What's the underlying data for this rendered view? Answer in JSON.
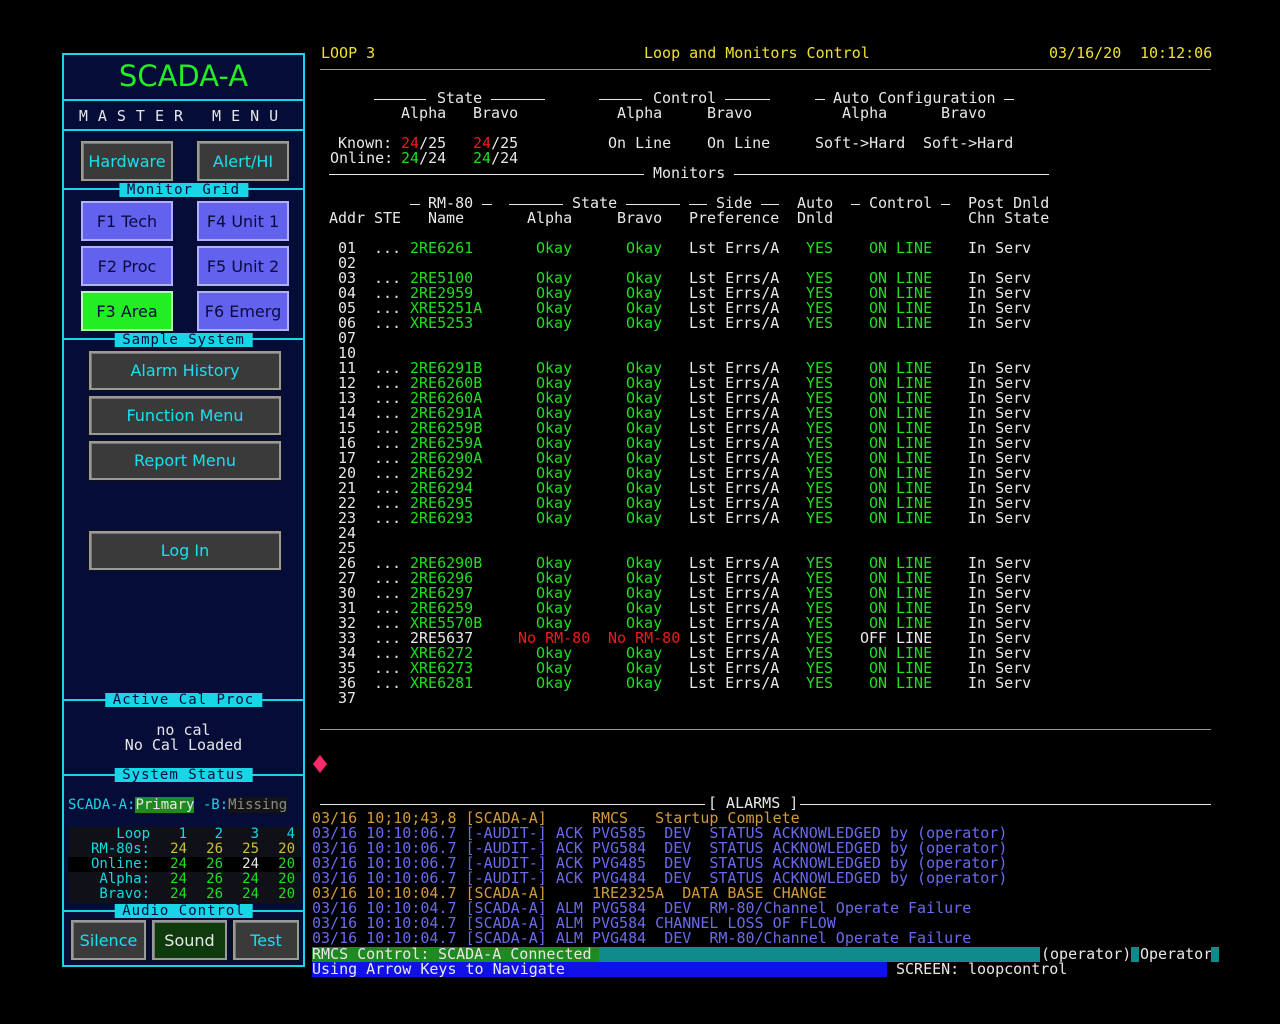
{
  "left_panel": {
    "title": "SCADA-A",
    "master_menu": "MASTER  MENU",
    "buttons_top": {
      "hardware": "Hardware",
      "alert": "Alert/HI"
    },
    "monitor_grid_label": "Monitor Grid",
    "grid_buttons": {
      "f1": "F1 Tech",
      "f4": "F4 Unit 1",
      "f2": "F2 Proc",
      "f5": "F5 Unit 2",
      "f3": "F3 Area",
      "f6": "F6 Emerg"
    },
    "sample_system_label": "Sample System",
    "menu_buttons": {
      "alarm_history": "Alarm History",
      "function_menu": "Function Menu",
      "report_menu": "Report Menu",
      "log_in": "Log In"
    },
    "active_cal_label": "Active Cal Proc",
    "cal_line1": "no cal",
    "cal_line2": "No Cal Loaded",
    "system_status_label": "System  Status",
    "scada_a_label": "SCADA-A:",
    "scada_a_value": "Primary",
    "scada_b_label": " -B:",
    "scada_b_value": "Missing",
    "loop_grid": {
      "rows": [
        {
          "label": "Loop",
          "values": [
            "1",
            "2",
            "3",
            "4"
          ]
        },
        {
          "label": "RM-80s:",
          "values": [
            "24",
            "26",
            "25",
            "20"
          ]
        },
        {
          "label": "Online:",
          "values": [
            "24",
            "26",
            "24",
            "20"
          ]
        },
        {
          "label": "Alpha:",
          "values": [
            "24",
            "26",
            "24",
            "20"
          ]
        },
        {
          "label": "Bravo:",
          "values": [
            "24",
            "26",
            "24",
            "20"
          ]
        }
      ]
    },
    "audio_control_label": "Audio Control",
    "audio_buttons": {
      "silence": "Silence",
      "sound": "Sound",
      "test": "Test"
    }
  },
  "header": {
    "loop": "LOOP 3",
    "title": "Loop and Monitors Control",
    "date": "03/16/20",
    "time": "10:12:06"
  },
  "summary": {
    "state_heading": "State",
    "control_heading": "Control",
    "auto_config_heading": "Auto Configuration",
    "alpha": "Alpha",
    "bravo": "Bravo",
    "known_label": "Known:",
    "online_label": "Online:",
    "known_alpha_num": "24",
    "known_alpha_den": "/25",
    "known_bravo_num": "24",
    "known_bravo_den": "/25",
    "online_alpha_num": "24",
    "online_alpha_den": "/24",
    "online_bravo_num": "24",
    "online_bravo_den": "/24",
    "control_alpha": "On Line",
    "control_bravo": "On Line",
    "auto_alpha": "Soft->Hard",
    "auto_bravo": "Soft->Hard",
    "monitors_heading": "Monitors"
  },
  "monitor_headers": {
    "addr": "Addr",
    "ste": "STE",
    "rm80_top": "RM-80",
    "rm80_bottom": "Name",
    "state_top": "State",
    "state_alpha": "Alpha",
    "state_bravo": "Bravo",
    "side_top": "Side",
    "side_bottom": "Preference",
    "auto_top": "Auto",
    "auto_bottom": "Dnld",
    "control_top": "Control",
    "post_top": "Post Dnld",
    "post_bottom": "Chn State"
  },
  "monitor_rows": [
    {
      "addr": "01",
      "ste": "...",
      "name": "2RE6261",
      "alpha": "Okay",
      "bravo": "Okay",
      "side": "Lst Errs/A",
      "auto": "YES",
      "ctl1": "ON",
      "ctl2": "LINE",
      "post": "In Serv"
    },
    {
      "addr": "02",
      "ste": "",
      "name": "",
      "alpha": "",
      "bravo": "",
      "side": "",
      "auto": "",
      "ctl1": "",
      "ctl2": "",
      "post": ""
    },
    {
      "addr": "03",
      "ste": "...",
      "name": "2RE5100",
      "alpha": "Okay",
      "bravo": "Okay",
      "side": "Lst Errs/A",
      "auto": "YES",
      "ctl1": "ON",
      "ctl2": "LINE",
      "post": "In Serv"
    },
    {
      "addr": "04",
      "ste": "...",
      "name": "2RE2959",
      "alpha": "Okay",
      "bravo": "Okay",
      "side": "Lst Errs/A",
      "auto": "YES",
      "ctl1": "ON",
      "ctl2": "LINE",
      "post": "In Serv"
    },
    {
      "addr": "05",
      "ste": "...",
      "name": "XRE5251A",
      "alpha": "Okay",
      "bravo": "Okay",
      "side": "Lst Errs/A",
      "auto": "YES",
      "ctl1": "ON",
      "ctl2": "LINE",
      "post": "In Serv"
    },
    {
      "addr": "06",
      "ste": "...",
      "name": "XRE5253",
      "alpha": "Okay",
      "bravo": "Okay",
      "side": "Lst Errs/A",
      "auto": "YES",
      "ctl1": "ON",
      "ctl2": "LINE",
      "post": "In Serv"
    },
    {
      "addr": "07",
      "ste": "",
      "name": "",
      "alpha": "",
      "bravo": "",
      "side": "",
      "auto": "",
      "ctl1": "",
      "ctl2": "",
      "post": ""
    },
    {
      "addr": "10",
      "ste": "",
      "name": "",
      "alpha": "",
      "bravo": "",
      "side": "",
      "auto": "",
      "ctl1": "",
      "ctl2": "",
      "post": ""
    },
    {
      "addr": "11",
      "ste": "...",
      "name": "2RE6291B",
      "alpha": "Okay",
      "bravo": "Okay",
      "side": "Lst Errs/A",
      "auto": "YES",
      "ctl1": "ON",
      "ctl2": "LINE",
      "post": "In Serv"
    },
    {
      "addr": "12",
      "ste": "...",
      "name": "2RE6260B",
      "alpha": "Okay",
      "bravo": "Okay",
      "side": "Lst Errs/A",
      "auto": "YES",
      "ctl1": "ON",
      "ctl2": "LINE",
      "post": "In Serv"
    },
    {
      "addr": "13",
      "ste": "...",
      "name": "2RE6260A",
      "alpha": "Okay",
      "bravo": "Okay",
      "side": "Lst Errs/A",
      "auto": "YES",
      "ctl1": "ON",
      "ctl2": "LINE",
      "post": "In Serv"
    },
    {
      "addr": "14",
      "ste": "...",
      "name": "2RE6291A",
      "alpha": "Okay",
      "bravo": "Okay",
      "side": "Lst Errs/A",
      "auto": "YES",
      "ctl1": "ON",
      "ctl2": "LINE",
      "post": "In Serv"
    },
    {
      "addr": "15",
      "ste": "...",
      "name": "2RE6259B",
      "alpha": "Okay",
      "bravo": "Okay",
      "side": "Lst Errs/A",
      "auto": "YES",
      "ctl1": "ON",
      "ctl2": "LINE",
      "post": "In Serv"
    },
    {
      "addr": "16",
      "ste": "...",
      "name": "2RE6259A",
      "alpha": "Okay",
      "bravo": "Okay",
      "side": "Lst Errs/A",
      "auto": "YES",
      "ctl1": "ON",
      "ctl2": "LINE",
      "post": "In Serv"
    },
    {
      "addr": "17",
      "ste": "...",
      "name": "2RE6290A",
      "alpha": "Okay",
      "bravo": "Okay",
      "side": "Lst Errs/A",
      "auto": "YES",
      "ctl1": "ON",
      "ctl2": "LINE",
      "post": "In Serv"
    },
    {
      "addr": "20",
      "ste": "...",
      "name": "2RE6292",
      "alpha": "Okay",
      "bravo": "Okay",
      "side": "Lst Errs/A",
      "auto": "YES",
      "ctl1": "ON",
      "ctl2": "LINE",
      "post": "In Serv"
    },
    {
      "addr": "21",
      "ste": "...",
      "name": "2RE6294",
      "alpha": "Okay",
      "bravo": "Okay",
      "side": "Lst Errs/A",
      "auto": "YES",
      "ctl1": "ON",
      "ctl2": "LINE",
      "post": "In Serv"
    },
    {
      "addr": "22",
      "ste": "...",
      "name": "2RE6295",
      "alpha": "Okay",
      "bravo": "Okay",
      "side": "Lst Errs/A",
      "auto": "YES",
      "ctl1": "ON",
      "ctl2": "LINE",
      "post": "In Serv"
    },
    {
      "addr": "23",
      "ste": "...",
      "name": "2RE6293",
      "alpha": "Okay",
      "bravo": "Okay",
      "side": "Lst Errs/A",
      "auto": "YES",
      "ctl1": "ON",
      "ctl2": "LINE",
      "post": "In Serv"
    },
    {
      "addr": "24",
      "ste": "",
      "name": "",
      "alpha": "",
      "bravo": "",
      "side": "",
      "auto": "",
      "ctl1": "",
      "ctl2": "",
      "post": ""
    },
    {
      "addr": "25",
      "ste": "",
      "name": "",
      "alpha": "",
      "bravo": "",
      "side": "",
      "auto": "",
      "ctl1": "",
      "ctl2": "",
      "post": ""
    },
    {
      "addr": "26",
      "ste": "...",
      "name": "2RE6290B",
      "alpha": "Okay",
      "bravo": "Okay",
      "side": "Lst Errs/A",
      "auto": "YES",
      "ctl1": "ON",
      "ctl2": "LINE",
      "post": "In Serv"
    },
    {
      "addr": "27",
      "ste": "...",
      "name": "2RE6296",
      "alpha": "Okay",
      "bravo": "Okay",
      "side": "Lst Errs/A",
      "auto": "YES",
      "ctl1": "ON",
      "ctl2": "LINE",
      "post": "In Serv"
    },
    {
      "addr": "30",
      "ste": "...",
      "name": "2RE6297",
      "alpha": "Okay",
      "bravo": "Okay",
      "side": "Lst Errs/A",
      "auto": "YES",
      "ctl1": "ON",
      "ctl2": "LINE",
      "post": "In Serv"
    },
    {
      "addr": "31",
      "ste": "...",
      "name": "2RE6259",
      "alpha": "Okay",
      "bravo": "Okay",
      "side": "Lst Errs/A",
      "auto": "YES",
      "ctl1": "ON",
      "ctl2": "LINE",
      "post": "In Serv"
    },
    {
      "addr": "32",
      "ste": "...",
      "name": "XRE5570B",
      "alpha": "Okay",
      "bravo": "Okay",
      "side": "Lst Errs/A",
      "auto": "YES",
      "ctl1": "ON",
      "ctl2": "LINE",
      "post": "In Serv"
    },
    {
      "addr": "33",
      "ste": "...",
      "name": "2RE5637",
      "alpha": "No RM-80",
      "bravo": "No RM-80",
      "side": "Lst Errs/A",
      "auto": "YES",
      "ctl1": "OFF",
      "ctl2": "LINE",
      "post": "In Serv",
      "fault": true
    },
    {
      "addr": "34",
      "ste": "...",
      "name": "XRE6272",
      "alpha": "Okay",
      "bravo": "Okay",
      "side": "Lst Errs/A",
      "auto": "YES",
      "ctl1": "ON",
      "ctl2": "LINE",
      "post": "In Serv"
    },
    {
      "addr": "35",
      "ste": "...",
      "name": "XRE6273",
      "alpha": "Okay",
      "bravo": "Okay",
      "side": "Lst Errs/A",
      "auto": "YES",
      "ctl1": "ON",
      "ctl2": "LINE",
      "post": "In Serv"
    },
    {
      "addr": "36",
      "ste": "...",
      "name": "XRE6281",
      "alpha": "Okay",
      "bravo": "Okay",
      "side": "Lst Errs/A",
      "auto": "YES",
      "ctl1": "ON",
      "ctl2": "LINE",
      "post": "In Serv"
    },
    {
      "addr": "37",
      "ste": "",
      "name": "",
      "alpha": "",
      "bravo": "",
      "side": "",
      "auto": "",
      "ctl1": "",
      "ctl2": "",
      "post": ""
    }
  ],
  "alarms": {
    "heading": "[ ALARMS ]",
    "lines": [
      {
        "text": "03/16 10;10;43,8 [SCADA-A]     RMCS   Startup Complete",
        "color": "#d29a3a"
      },
      {
        "text": "03/16 10:10:06.7 [-AUDIT-] ACK PVG585  DEV  STATUS ACKNOWLEDGED by (operator)",
        "color": "#6a6aee"
      },
      {
        "text": "03/16 10:10:06.7 [-AUDIT-] ACK PVG584  DEV  STATUS ACKNOWLEDGED by (operator)",
        "color": "#6a6aee"
      },
      {
        "text": "03/16 10:10:06.7 [-AUDIT-] ACK PVG485  DEV  STATUS ACKNOWLEDGED by (operator)",
        "color": "#6a6aee"
      },
      {
        "text": "03/16 10:10:06.7 [-AUDIT-] ACK PVG484  DEV  STATUS ACKNOWLEDGED by (operator)",
        "color": "#6a6aee"
      },
      {
        "text": "03/16 10:10:04.7 [SCADA-A]     1RE2325A  DATA BASE CHANGE",
        "color": "#d29a3a"
      },
      {
        "text": "03/16 10:10:04.7 [SCADA-A] ALM PVG584  DEV  RM-80/Channel Operate Failure",
        "color": "#6a6aee"
      },
      {
        "text": "03/16 10:10:04.7 [SCADA-A] ALM PVG584 CHANNEL LOSS OF FLOW",
        "color": "#6a6aee"
      },
      {
        "text": "03/16 10:10:04.7 [SCADA-A] ALM PVG484  DEV  RM-80/Channel Operate Failure",
        "color": "#6a6aee"
      }
    ]
  },
  "status_bar": {
    "rmcs_label": "RMCS Control:",
    "rmcs_value": " SCADA-A Connected",
    "user": "(operator)",
    "role": "Operator",
    "hint": "Using Arrow Keys to Navigate",
    "screen_label": "SCREEN:",
    "screen_value": "loopcontrol"
  },
  "colors": {
    "cyan": "#19d6e6",
    "green": "#22dd22",
    "red": "#ee1c1c",
    "yellow": "#f0e030",
    "orange": "#d29a3a",
    "blue": "#6a6aee",
    "panel": "#050c38"
  }
}
